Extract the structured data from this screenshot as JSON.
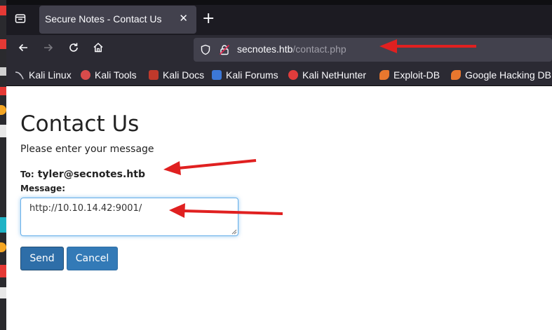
{
  "browser": {
    "tab_title": "Secure Notes - Contact Us",
    "tab_close": "✕",
    "new_tab": "+",
    "url_host": "secnotes.htb",
    "url_path": "/contact.php"
  },
  "bookmarks": [
    {
      "label": "Kali Linux",
      "icon_color": "#6a9fd8"
    },
    {
      "label": "Kali Tools",
      "icon_color": "#d84b4b"
    },
    {
      "label": "Kali Docs",
      "icon_color": "#c0392b"
    },
    {
      "label": "Kali Forums",
      "icon_color": "#3c78d8"
    },
    {
      "label": "Kali NetHunter",
      "icon_color": "#e03c3c"
    },
    {
      "label": "Exploit-DB",
      "icon_color": "#e8772e"
    },
    {
      "label": "Google Hacking DB",
      "icon_color": "#e8772e"
    }
  ],
  "page": {
    "title": "Contact Us",
    "intro": "Please enter your message",
    "to_label": "To:",
    "to_value": "tyler@secnotes.htb",
    "message_label": "Message:",
    "message_value": "http://10.10.14.42:9001/",
    "send_label": "Send",
    "cancel_label": "Cancel"
  },
  "colors": {
    "annotation_arrow": "#e02020",
    "send_button": "#2e6ea8",
    "cancel_button": "#337ab7"
  }
}
